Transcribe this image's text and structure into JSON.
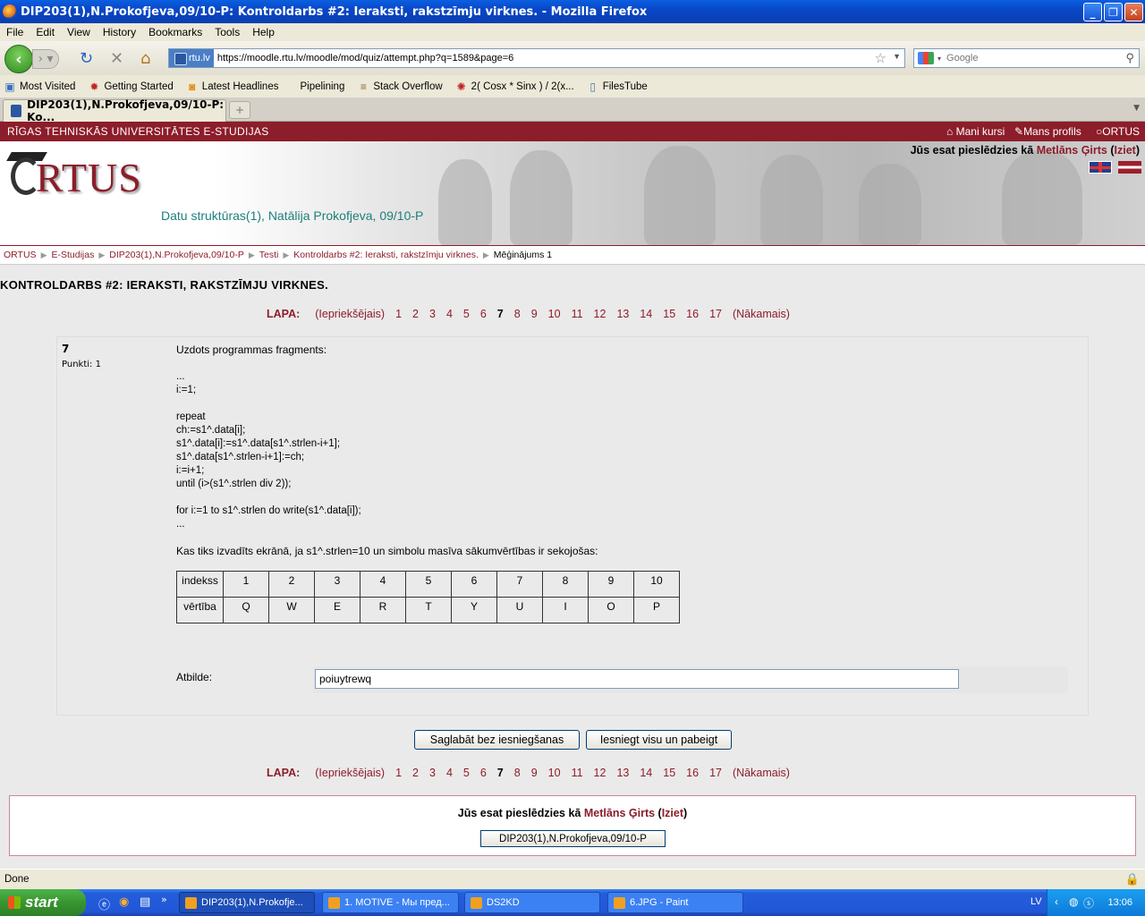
{
  "window": {
    "title": "DIP203(1),N.Prokofjeva,09/10-P: Kontroldarbs #2: Ieraksti, rakstzīmju virknes. - Mozilla Firefox"
  },
  "menu": [
    "File",
    "Edit",
    "View",
    "History",
    "Bookmarks",
    "Tools",
    "Help"
  ],
  "nav": {
    "site_badge": "rtu.lv",
    "url": "https://moodle.rtu.lv/moodle/mod/quiz/attempt.php?q=1589&page=6",
    "search_placeholder": "Google"
  },
  "bookmarks": [
    "Most Visited",
    "Getting Started",
    "Latest Headlines",
    "Pipelining",
    "Stack Overflow",
    "2( Cosx * Sinx ) / 2(x...",
    "FilesTube"
  ],
  "tab": {
    "label": "DIP203(1),N.Prokofjeva,09/10-P: Ko..."
  },
  "site": {
    "top_title": "RĪGAS TEHNISKĀS UNIVERSITĀTES E-STUDIJAS",
    "top_links": [
      "Mani kursi",
      "Mans profils",
      "ORTUS"
    ],
    "logo_text": "RTUS",
    "logged_prefix": "Jūs esat pieslēdzies kā",
    "user": "Metlāns Ģirts",
    "logout": "Iziet",
    "course": "Datu struktūras(1), Natālija Prokofjeva, 09/10-P"
  },
  "breadcrumb": [
    "ORTUS",
    "E-Studijas",
    "DIP203(1),N.Prokofjeva,09/10-P",
    "Testi",
    "Kontroldarbs #2: Ieraksti, rakstzīmju virknes.",
    "Mēģinājums 1"
  ],
  "page_title": "KONTROLDARBS #2: IERAKSTI, RAKSTZĪMJU VIRKNES.",
  "pager": {
    "label": "LAPA:",
    "prev": "(Iepriekšējais)",
    "pages": [
      "1",
      "2",
      "3",
      "4",
      "5",
      "6",
      "7",
      "8",
      "9",
      "10",
      "11",
      "12",
      "13",
      "14",
      "15",
      "16",
      "17"
    ],
    "current": "7",
    "next": "(Nākamais)"
  },
  "question": {
    "number": "7",
    "points": "Punkti: 1",
    "intro": "Uzdots programmas fragments:",
    "code": "...\ni:=1;\n\nrepeat\nch:=s1^.data[i];\ns1^.data[i]:=s1^.data[s1^.strlen-i+1];\ns1^.data[s1^.strlen-i+1]:=ch;\ni:=i+1;\nuntil (i>(s1^.strlen div 2));\n\nfor i:=1 to s1^.strlen do write(s1^.data[i]);\n...",
    "prompt": "Kas tiks izvadīts ekrānā, ja s1^.strlen=10 un simbolu masīva sākumvērtības ir sekojošas:",
    "table": {
      "row1": [
        "indekss",
        "1",
        "2",
        "3",
        "4",
        "5",
        "6",
        "7",
        "8",
        "9",
        "10"
      ],
      "row2": [
        "vērtība",
        "Q",
        "W",
        "E",
        "R",
        "T",
        "Y",
        "U",
        "I",
        "O",
        "P"
      ]
    },
    "answer_label": "Atbilde:",
    "answer_value": "poiuytrewq"
  },
  "buttons": {
    "save": "Saglabāt bez iesniegšanas",
    "submit": "Iesniegt visu un pabeigt",
    "course": "DIP203(1),N.Prokofjeva,09/10-P"
  },
  "status": "Done",
  "taskbar": {
    "start": "start",
    "tasks": [
      "DIP203(1),N.Prokofje...",
      "1. MOTIVE - Мы пред...",
      "DS2KD",
      "6.JPG - Paint"
    ],
    "lang": "LV",
    "time": "13:06"
  }
}
